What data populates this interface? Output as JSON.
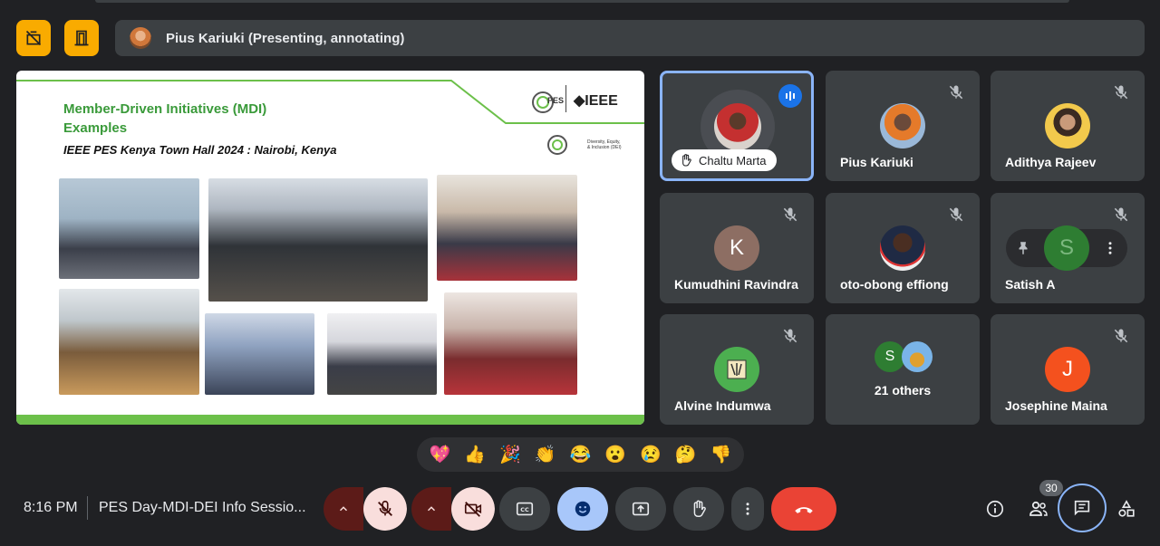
{
  "presenter": {
    "label": "Pius Kariuki (Presenting, annotating)"
  },
  "slide": {
    "title_line1": "Member-Driven Initiatives (MDI)",
    "title_line2": "Examples",
    "subtitle": "IEEE PES Kenya Town Hall 2024 : Nairobi, Kenya",
    "logo_ieee": "◆IEEE",
    "logo_pes": "PES",
    "dei_label": "Diversity, Equity,\n& Inclusion (DEI)"
  },
  "participants": [
    {
      "name": "Chaltu Marta",
      "raised_hand": true,
      "speaking": true
    },
    {
      "name": "Pius Kariuki",
      "muted": true
    },
    {
      "name": "Adithya Rajeev",
      "muted": true
    },
    {
      "name": "Kumudhini Ravindra",
      "muted": true,
      "letter": "K"
    },
    {
      "name": "oto-obong effiong",
      "muted": true
    },
    {
      "name": "Satish A",
      "muted": true,
      "letter": "S"
    },
    {
      "name": "Alvine Indumwa",
      "muted": true
    },
    {
      "name": "21 others",
      "letter": "S"
    },
    {
      "name": "Josephine Maina",
      "muted": true,
      "letter": "J"
    }
  ],
  "reactions": [
    "💖",
    "👍",
    "🎉",
    "👏",
    "😂",
    "😮",
    "😢",
    "🤔",
    "👎"
  ],
  "footer": {
    "time": "8:16 PM",
    "meeting_title": "PES Day-MDI-DEI Info Sessio...",
    "people_count": "30"
  },
  "colors": {
    "background": "#202124",
    "tile": "#3c4043",
    "accent_yellow": "#f9ab00",
    "hangup_red": "#ea4335",
    "active_blue": "#8ab4f8",
    "slide_green": "#6cc04a"
  }
}
